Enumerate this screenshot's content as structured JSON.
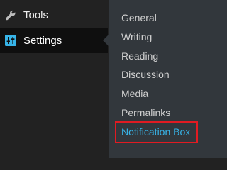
{
  "sidebar": {
    "items": [
      {
        "label": "Tools",
        "icon": "wrench-icon"
      },
      {
        "label": "Settings",
        "icon": "sliders-icon",
        "selected": true
      }
    ]
  },
  "submenu": {
    "items": [
      {
        "label": "General"
      },
      {
        "label": "Writing"
      },
      {
        "label": "Reading"
      },
      {
        "label": "Discussion"
      },
      {
        "label": "Media"
      },
      {
        "label": "Permalinks"
      },
      {
        "label": "Notification Box",
        "highlighted": true
      }
    ]
  },
  "colors": {
    "sidebar_bg": "#222222",
    "selected_bg": "#0f0f0f",
    "submenu_bg": "#32373c",
    "submenu_text": "#d0d0d0",
    "active_text": "#37b4e8",
    "highlight_border": "#e11b22",
    "settings_icon": "#37b4e8"
  }
}
